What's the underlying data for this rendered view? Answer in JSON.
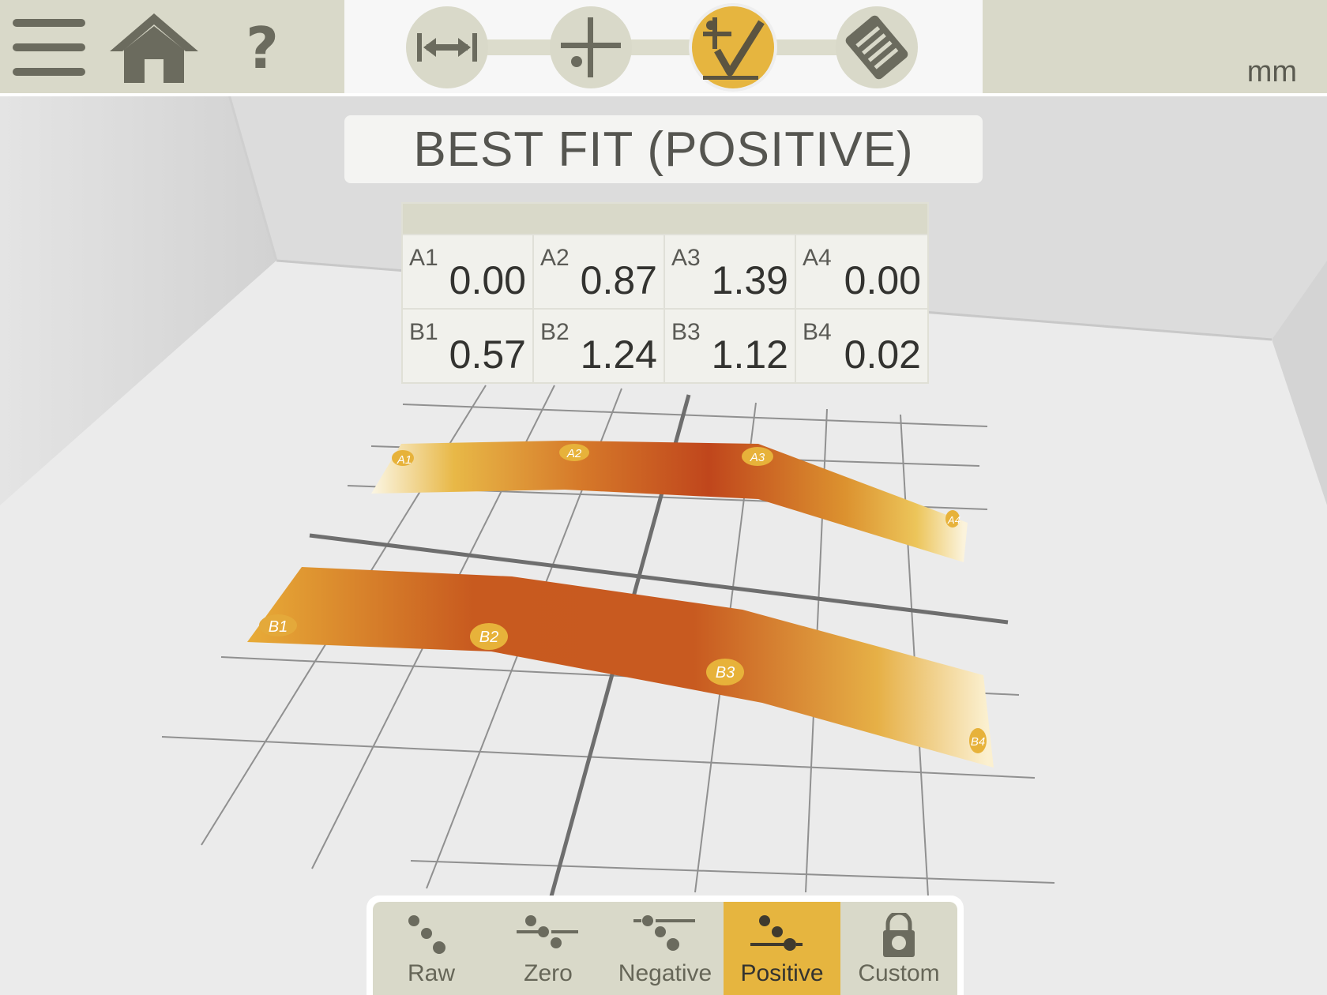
{
  "header": {
    "menu_icon": "hamburger-menu-icon",
    "home_icon": "home-icon",
    "help_glyph": "?",
    "unit": "mm",
    "steps": [
      {
        "icon": "measure-distance-icon",
        "active": false
      },
      {
        "icon": "crosshair-point-icon",
        "active": false
      },
      {
        "icon": "flatness-check-icon",
        "active": true
      },
      {
        "icon": "report-save-icon",
        "active": false
      }
    ]
  },
  "title": "BEST FIT (POSITIVE)",
  "readings": {
    "rows": [
      [
        {
          "label": "A1",
          "value": "0.00"
        },
        {
          "label": "A2",
          "value": "0.87"
        },
        {
          "label": "A3",
          "value": "1.39"
        },
        {
          "label": "A4",
          "value": "0.00"
        }
      ],
      [
        {
          "label": "B1",
          "value": "0.57"
        },
        {
          "label": "B2",
          "value": "1.24"
        },
        {
          "label": "B3",
          "value": "1.12"
        },
        {
          "label": "B4",
          "value": "0.02"
        }
      ]
    ]
  },
  "view3d": {
    "marker_labels": [
      "A1",
      "A2",
      "A3",
      "A4",
      "B1",
      "B2",
      "B3",
      "B4"
    ],
    "colors": {
      "low": "#fbf6e4",
      "mid": "#e6b53f",
      "high": "#c0461c"
    }
  },
  "modes": [
    {
      "label": "Raw",
      "icon": "raw-mode-icon",
      "active": false
    },
    {
      "label": "Zero",
      "icon": "zero-mode-icon",
      "active": false
    },
    {
      "label": "Negative",
      "icon": "negative-mode-icon",
      "active": false
    },
    {
      "label": "Positive",
      "icon": "positive-mode-icon",
      "active": true
    },
    {
      "label": "Custom",
      "icon": "lock-icon",
      "active": false
    }
  ]
}
